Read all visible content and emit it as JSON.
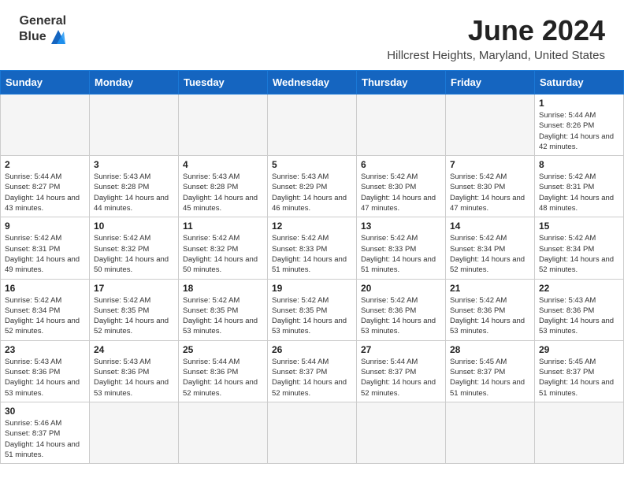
{
  "header": {
    "logo_text_general": "General",
    "logo_text_blue": "Blue",
    "month_title": "June 2024",
    "location": "Hillcrest Heights, Maryland, United States"
  },
  "weekdays": [
    "Sunday",
    "Monday",
    "Tuesday",
    "Wednesday",
    "Thursday",
    "Friday",
    "Saturday"
  ],
  "weeks": [
    [
      {
        "day": "",
        "sunrise": "",
        "sunset": "",
        "daylight": "",
        "empty": true
      },
      {
        "day": "",
        "sunrise": "",
        "sunset": "",
        "daylight": "",
        "empty": true
      },
      {
        "day": "",
        "sunrise": "",
        "sunset": "",
        "daylight": "",
        "empty": true
      },
      {
        "day": "",
        "sunrise": "",
        "sunset": "",
        "daylight": "",
        "empty": true
      },
      {
        "day": "",
        "sunrise": "",
        "sunset": "",
        "daylight": "",
        "empty": true
      },
      {
        "day": "",
        "sunrise": "",
        "sunset": "",
        "daylight": "",
        "empty": true
      },
      {
        "day": "1",
        "sunrise": "5:44 AM",
        "sunset": "8:26 PM",
        "daylight": "14 hours and 42 minutes.",
        "empty": false
      }
    ],
    [
      {
        "day": "2",
        "sunrise": "5:44 AM",
        "sunset": "8:27 PM",
        "daylight": "14 hours and 43 minutes.",
        "empty": false
      },
      {
        "day": "3",
        "sunrise": "5:43 AM",
        "sunset": "8:28 PM",
        "daylight": "14 hours and 44 minutes.",
        "empty": false
      },
      {
        "day": "4",
        "sunrise": "5:43 AM",
        "sunset": "8:28 PM",
        "daylight": "14 hours and 45 minutes.",
        "empty": false
      },
      {
        "day": "5",
        "sunrise": "5:43 AM",
        "sunset": "8:29 PM",
        "daylight": "14 hours and 46 minutes.",
        "empty": false
      },
      {
        "day": "6",
        "sunrise": "5:42 AM",
        "sunset": "8:30 PM",
        "daylight": "14 hours and 47 minutes.",
        "empty": false
      },
      {
        "day": "7",
        "sunrise": "5:42 AM",
        "sunset": "8:30 PM",
        "daylight": "14 hours and 47 minutes.",
        "empty": false
      },
      {
        "day": "8",
        "sunrise": "5:42 AM",
        "sunset": "8:31 PM",
        "daylight": "14 hours and 48 minutes.",
        "empty": false
      }
    ],
    [
      {
        "day": "9",
        "sunrise": "5:42 AM",
        "sunset": "8:31 PM",
        "daylight": "14 hours and 49 minutes.",
        "empty": false
      },
      {
        "day": "10",
        "sunrise": "5:42 AM",
        "sunset": "8:32 PM",
        "daylight": "14 hours and 50 minutes.",
        "empty": false
      },
      {
        "day": "11",
        "sunrise": "5:42 AM",
        "sunset": "8:32 PM",
        "daylight": "14 hours and 50 minutes.",
        "empty": false
      },
      {
        "day": "12",
        "sunrise": "5:42 AM",
        "sunset": "8:33 PM",
        "daylight": "14 hours and 51 minutes.",
        "empty": false
      },
      {
        "day": "13",
        "sunrise": "5:42 AM",
        "sunset": "8:33 PM",
        "daylight": "14 hours and 51 minutes.",
        "empty": false
      },
      {
        "day": "14",
        "sunrise": "5:42 AM",
        "sunset": "8:34 PM",
        "daylight": "14 hours and 52 minutes.",
        "empty": false
      },
      {
        "day": "15",
        "sunrise": "5:42 AM",
        "sunset": "8:34 PM",
        "daylight": "14 hours and 52 minutes.",
        "empty": false
      }
    ],
    [
      {
        "day": "16",
        "sunrise": "5:42 AM",
        "sunset": "8:34 PM",
        "daylight": "14 hours and 52 minutes.",
        "empty": false
      },
      {
        "day": "17",
        "sunrise": "5:42 AM",
        "sunset": "8:35 PM",
        "daylight": "14 hours and 52 minutes.",
        "empty": false
      },
      {
        "day": "18",
        "sunrise": "5:42 AM",
        "sunset": "8:35 PM",
        "daylight": "14 hours and 53 minutes.",
        "empty": false
      },
      {
        "day": "19",
        "sunrise": "5:42 AM",
        "sunset": "8:35 PM",
        "daylight": "14 hours and 53 minutes.",
        "empty": false
      },
      {
        "day": "20",
        "sunrise": "5:42 AM",
        "sunset": "8:36 PM",
        "daylight": "14 hours and 53 minutes.",
        "empty": false
      },
      {
        "day": "21",
        "sunrise": "5:42 AM",
        "sunset": "8:36 PM",
        "daylight": "14 hours and 53 minutes.",
        "empty": false
      },
      {
        "day": "22",
        "sunrise": "5:43 AM",
        "sunset": "8:36 PM",
        "daylight": "14 hours and 53 minutes.",
        "empty": false
      }
    ],
    [
      {
        "day": "23",
        "sunrise": "5:43 AM",
        "sunset": "8:36 PM",
        "daylight": "14 hours and 53 minutes.",
        "empty": false
      },
      {
        "day": "24",
        "sunrise": "5:43 AM",
        "sunset": "8:36 PM",
        "daylight": "14 hours and 53 minutes.",
        "empty": false
      },
      {
        "day": "25",
        "sunrise": "5:44 AM",
        "sunset": "8:36 PM",
        "daylight": "14 hours and 52 minutes.",
        "empty": false
      },
      {
        "day": "26",
        "sunrise": "5:44 AM",
        "sunset": "8:37 PM",
        "daylight": "14 hours and 52 minutes.",
        "empty": false
      },
      {
        "day": "27",
        "sunrise": "5:44 AM",
        "sunset": "8:37 PM",
        "daylight": "14 hours and 52 minutes.",
        "empty": false
      },
      {
        "day": "28",
        "sunrise": "5:45 AM",
        "sunset": "8:37 PM",
        "daylight": "14 hours and 51 minutes.",
        "empty": false
      },
      {
        "day": "29",
        "sunrise": "5:45 AM",
        "sunset": "8:37 PM",
        "daylight": "14 hours and 51 minutes.",
        "empty": false
      }
    ],
    [
      {
        "day": "30",
        "sunrise": "5:46 AM",
        "sunset": "8:37 PM",
        "daylight": "14 hours and 51 minutes.",
        "empty": false
      },
      {
        "day": "",
        "sunrise": "",
        "sunset": "",
        "daylight": "",
        "empty": true
      },
      {
        "day": "",
        "sunrise": "",
        "sunset": "",
        "daylight": "",
        "empty": true
      },
      {
        "day": "",
        "sunrise": "",
        "sunset": "",
        "daylight": "",
        "empty": true
      },
      {
        "day": "",
        "sunrise": "",
        "sunset": "",
        "daylight": "",
        "empty": true
      },
      {
        "day": "",
        "sunrise": "",
        "sunset": "",
        "daylight": "",
        "empty": true
      },
      {
        "day": "",
        "sunrise": "",
        "sunset": "",
        "daylight": "",
        "empty": true
      }
    ]
  ]
}
